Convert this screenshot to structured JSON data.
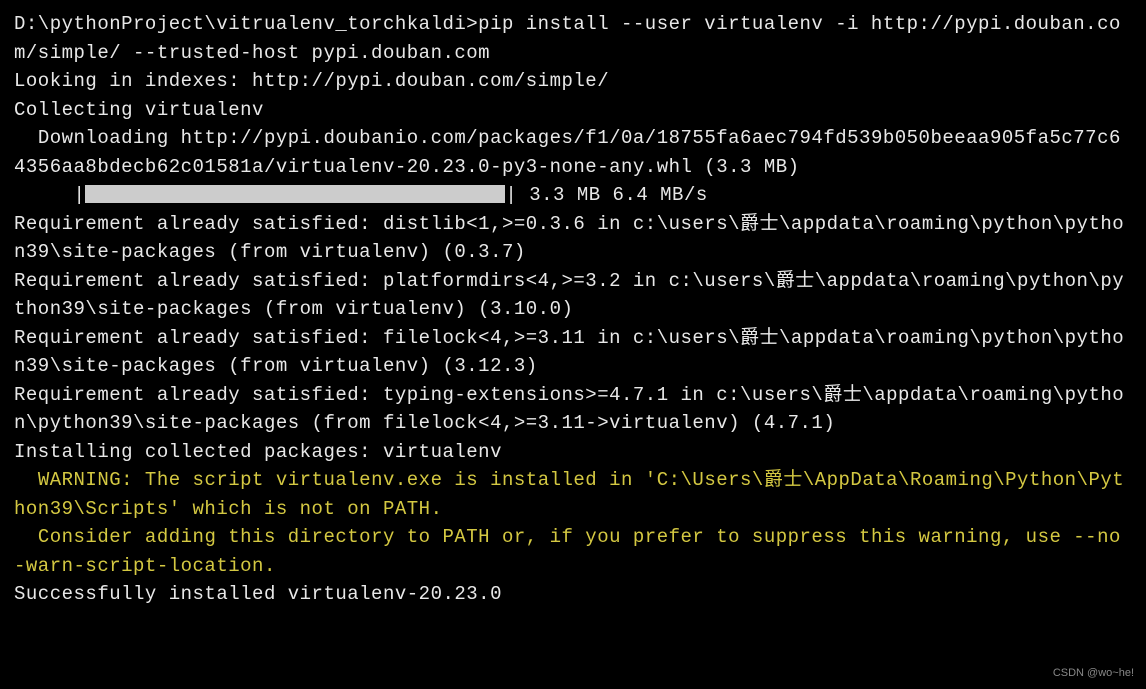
{
  "terminal": {
    "prompt_and_command": "D:\\pythonProject\\vitrualenv_torchkaldi>pip install --user virtualenv -i http://pypi.douban.com/simple/ --trusted-host pypi.douban.com",
    "looking_indexes": "Looking in indexes: http://pypi.douban.com/simple/",
    "collecting": "Collecting virtualenv",
    "downloading_line1": "  Downloading http://pypi.doubanio.com/packages/f1/0a/18755fa6aec794fd539b050beeaa905fa5c77c64356aa8bdecb62c01581a/virtualenv-20.23.0-py3-none-any.whl (3.3 MB)",
    "progress_prefix": "     |",
    "progress_suffix": "| 3.3 MB 6.4 MB/s",
    "req1": "Requirement already satisfied: distlib<1,>=0.3.6 in c:\\users\\爵士\\appdata\\roaming\\python\\python39\\site-packages (from virtualenv) (0.3.7)",
    "req2": "Requirement already satisfied: platformdirs<4,>=3.2 in c:\\users\\爵士\\appdata\\roaming\\python\\python39\\site-packages (from virtualenv) (3.10.0)",
    "req3": "Requirement already satisfied: filelock<4,>=3.11 in c:\\users\\爵士\\appdata\\roaming\\python\\python39\\site-packages (from virtualenv) (3.12.3)",
    "req4": "Requirement already satisfied: typing-extensions>=4.7.1 in c:\\users\\爵士\\appdata\\roaming\\python\\python39\\site-packages (from filelock<4,>=3.11->virtualenv) (4.7.1)",
    "installing": "Installing collected packages: virtualenv",
    "warning1": "  WARNING: The script virtualenv.exe is installed in 'C:\\Users\\爵士\\AppData\\Roaming\\Python\\Python39\\Scripts' which is not on PATH.",
    "warning2": "  Consider adding this directory to PATH or, if you prefer to suppress this warning, use --no-warn-script-location.",
    "success": "Successfully installed virtualenv-20.23.0"
  },
  "watermark": "CSDN @wo~he!"
}
